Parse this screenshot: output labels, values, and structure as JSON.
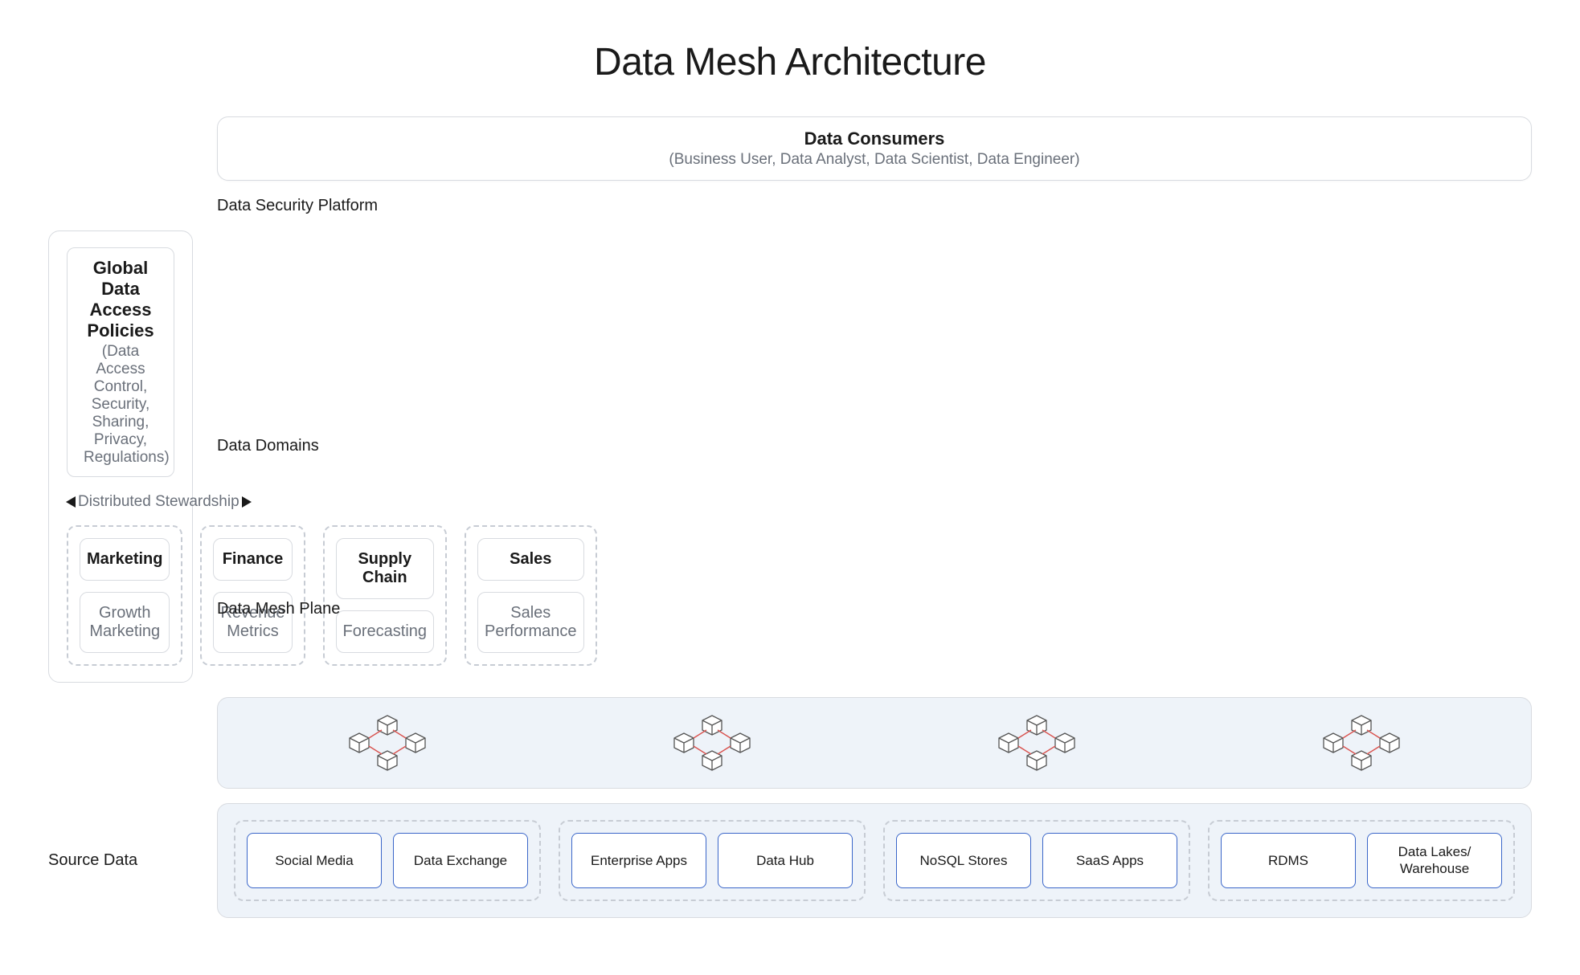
{
  "title": "Data Mesh Architecture",
  "consumers": {
    "title": "Data Consumers",
    "subtitle": "(Business User, Data Analyst, Data Scientist, Data Engineer)"
  },
  "security": {
    "row_label": "Data Security Platform",
    "policies_title": "Global Data Access Policies",
    "policies_subtitle": "(Data Access Control, Security, Sharing, Privacy, Regulations)",
    "stewardship_label": "Distributed Stewardship"
  },
  "domains": {
    "row_label": "Data Domains",
    "columns": [
      {
        "name": "Marketing",
        "detail": "Growth Marketing"
      },
      {
        "name": "Finance",
        "detail": "Revenue Metrics"
      },
      {
        "name": "Supply Chain",
        "detail": "Forecasting"
      },
      {
        "name": "Sales",
        "detail": "Sales Performance"
      }
    ]
  },
  "mesh_plane": {
    "row_label": "Data Mesh Plane"
  },
  "source_data": {
    "row_label": "Source Data",
    "columns": [
      {
        "a": "Social Media",
        "b": "Data Exchange"
      },
      {
        "a": "Enterprise Apps",
        "b": "Data Hub"
      },
      {
        "a": "NoSQL Stores",
        "b": "SaaS Apps"
      },
      {
        "a": "RDMS",
        "b": "Data Lakes/ Warehouse"
      }
    ]
  }
}
